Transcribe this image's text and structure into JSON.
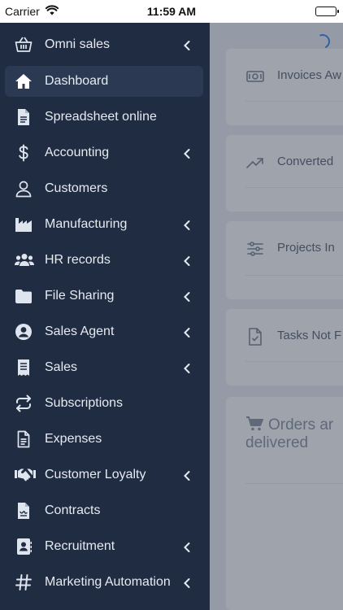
{
  "status_bar": {
    "carrier": "Carrier",
    "time": "11:59 AM"
  },
  "sidebar": {
    "items": [
      {
        "label": "Omni sales",
        "icon": "basket-icon",
        "has_submenu": true,
        "active": false
      },
      {
        "label": "Dashboard",
        "icon": "home-icon",
        "has_submenu": false,
        "active": true
      },
      {
        "label": "Spreadsheet online",
        "icon": "document-icon",
        "has_submenu": false,
        "active": false
      },
      {
        "label": "Accounting",
        "icon": "dollar-icon",
        "has_submenu": true,
        "active": false
      },
      {
        "label": "Customers",
        "icon": "user-icon",
        "has_submenu": false,
        "active": false
      },
      {
        "label": "Manufacturing",
        "icon": "factory-icon",
        "has_submenu": true,
        "active": false
      },
      {
        "label": "HR records",
        "icon": "users-icon",
        "has_submenu": true,
        "active": false
      },
      {
        "label": "File Sharing",
        "icon": "folder-icon",
        "has_submenu": true,
        "active": false
      },
      {
        "label": "Sales Agent",
        "icon": "user-circle-icon",
        "has_submenu": true,
        "active": false
      },
      {
        "label": "Sales",
        "icon": "receipt-icon",
        "has_submenu": true,
        "active": false
      },
      {
        "label": "Subscriptions",
        "icon": "repeat-icon",
        "has_submenu": false,
        "active": false
      },
      {
        "label": "Expenses",
        "icon": "file-text-icon",
        "has_submenu": false,
        "active": false
      },
      {
        "label": "Customer Loyalty",
        "icon": "handshake-icon",
        "has_submenu": true,
        "active": false
      },
      {
        "label": "Contracts",
        "icon": "contract-icon",
        "has_submenu": false,
        "active": false
      },
      {
        "label": "Recruitment",
        "icon": "contact-book-icon",
        "has_submenu": true,
        "active": false
      },
      {
        "label": "Marketing Automation",
        "icon": "hashtag-icon",
        "has_submenu": true,
        "active": false
      }
    ]
  },
  "dashboard": {
    "cards": [
      {
        "title": "Invoices Aw",
        "icon": "money-icon"
      },
      {
        "title": "Converted",
        "icon": "trending-up-icon"
      },
      {
        "title": "Projects In",
        "icon": "sliders-icon"
      },
      {
        "title": "Tasks Not F",
        "icon": "file-check-icon"
      }
    ],
    "orders_title": "Orders ar delivered"
  },
  "colors": {
    "sidebar_bg": "#202c41",
    "sidebar_active": "#2b3a52",
    "accent": "#3b82f6"
  }
}
